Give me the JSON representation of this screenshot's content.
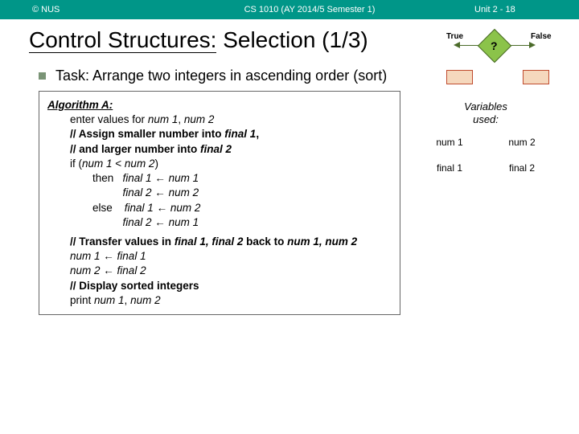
{
  "header": {
    "left": "© NUS",
    "center": "CS 1010 (AY 2014/5 Semester 1)",
    "right": "Unit 2 - 18"
  },
  "title": {
    "prefix": "Control Structures:",
    "suffix": " Selection (1/3)"
  },
  "diagram": {
    "question": "?",
    "true": "True",
    "false": "False"
  },
  "task": "Task: Arrange two integers in ascending order (sort)",
  "algo": {
    "title": "Algorithm A:",
    "l1a": "enter values for ",
    "l1b": "num 1",
    "l1c": ", ",
    "l1d": "num 2",
    "l2a": "// Assign smaller number into ",
    "l2b": "final 1",
    "l2c": ",",
    "l3a": "// and larger number into ",
    "l3b": "final 2",
    "l4a": "if (",
    "l4b": "num 1",
    "l4c": " < ",
    "l4d": "num 2",
    "l4e": ")",
    "l5a": "then   ",
    "l5b": "final 1",
    "l5c": " ← ",
    "l5d": "num 1",
    "l6a": "          ",
    "l6b": "final 2",
    "l6c": " ← ",
    "l6d": "num 2",
    "l7a": "else    ",
    "l7b": "final 1",
    "l7c": " ← ",
    "l7d": "num 2",
    "l8a": "          ",
    "l8b": "final 2",
    "l8c": " ← ",
    "l8d": "num 1",
    "l9a": "// Transfer values in ",
    "l9b": "final 1, final 2",
    "l9c": " back to ",
    "l9d": "num 1, num 2",
    "l10a": "num 1",
    "l10b": " ← ",
    "l10c": "final 1",
    "l11a": "num 2",
    "l11b": " ← ",
    "l11c": "final 2",
    "l12": "// Display sorted integers",
    "l13a": "print ",
    "l13b": "num 1",
    "l13c": ", ",
    "l13d": "num 2"
  },
  "vars": {
    "title1": "Variables",
    "title2": "used:",
    "v1": "num 1",
    "v2": "num 2",
    "v3": "final 1",
    "v4": "final 2"
  }
}
